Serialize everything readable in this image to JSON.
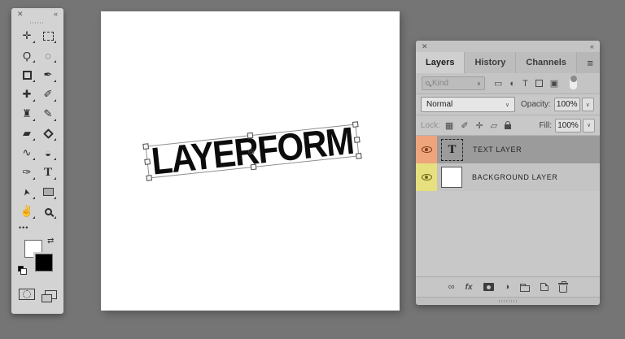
{
  "colors": {
    "workspace_background": "#757575",
    "canvas_background": "#FFFFFF",
    "selected_layer_row": "#9B9B9B",
    "text_layer_eye_background": "#EFA57C",
    "background_layer_eye_background": "#E6E07E",
    "foreground_swatch": "#FFFFFF",
    "background_swatch": "#000000"
  },
  "toolbar": {
    "close_icon": "✕",
    "collapse_icon": "«",
    "tools": [
      {
        "name": "move-tool",
        "glyph": "✛"
      },
      {
        "name": "rectangular-marquee-tool",
        "glyph": ""
      },
      {
        "name": "lasso-tool",
        "glyph": "Ϙ"
      },
      {
        "name": "quick-selection-tool",
        "glyph": "◌"
      },
      {
        "name": "crop-tool",
        "glyph": ""
      },
      {
        "name": "eyedropper-tool",
        "glyph": "✒"
      },
      {
        "name": "healing-brush-tool",
        "glyph": "✚"
      },
      {
        "name": "brush-tool",
        "glyph": "✐"
      },
      {
        "name": "clone-stamp-tool",
        "glyph": "♜"
      },
      {
        "name": "history-brush-tool",
        "glyph": "✎"
      },
      {
        "name": "eraser-tool",
        "glyph": "▰"
      },
      {
        "name": "paint-bucket-tool",
        "glyph": ""
      },
      {
        "name": "smudge-tool",
        "glyph": "∿"
      },
      {
        "name": "dodge-tool",
        "glyph": "◒"
      },
      {
        "name": "pen-tool",
        "glyph": "✑"
      },
      {
        "name": "type-tool",
        "glyph": "T"
      },
      {
        "name": "path-selection-tool",
        "glyph": "➤"
      },
      {
        "name": "shape-tool",
        "glyph": ""
      },
      {
        "name": "hand-tool",
        "glyph": "✌"
      },
      {
        "name": "zoom-tool",
        "glyph": ""
      }
    ],
    "more_tools_label": "•••",
    "swap_icon": "⇄"
  },
  "canvas": {
    "text": "LAYERFORM",
    "reference_icon": "⊕"
  },
  "layers_panel": {
    "close_icon": "✕",
    "collapse_icon": "«",
    "menu_icon": "≡",
    "chevron": "∨",
    "tabs": [
      {
        "label": "Layers",
        "active": true
      },
      {
        "label": "History",
        "active": false
      },
      {
        "label": "Channels",
        "active": false
      }
    ],
    "filter": {
      "placeholder": "Kind"
    },
    "filter_icons": [
      {
        "name": "filter-pixel-layers-icon",
        "glyph": "▭"
      },
      {
        "name": "filter-adjustment-layers-icon",
        "glyph": "◐"
      },
      {
        "name": "filter-type-layers-icon",
        "glyph": "T"
      },
      {
        "name": "filter-shape-layers-icon",
        "glyph": ""
      },
      {
        "name": "filter-smart-objects-icon",
        "glyph": "▣"
      }
    ],
    "blend": {
      "mode": "Normal",
      "opacity_label": "Opacity:",
      "opacity_value": "100%"
    },
    "lock": {
      "label": "Lock:",
      "icons": [
        {
          "name": "lock-transparency-icon",
          "glyph": "▦"
        },
        {
          "name": "lock-paint-icon",
          "glyph": "✐"
        },
        {
          "name": "lock-position-icon",
          "glyph": "✛"
        },
        {
          "name": "lock-artboard-icon",
          "glyph": "▱"
        },
        {
          "name": "lock-all-icon",
          "glyph": ""
        }
      ],
      "fill_label": "Fill:",
      "fill_value": "100%"
    },
    "layers": [
      {
        "name": "TEXT LAYER",
        "type": "text",
        "selected": true,
        "thumb_label": "T"
      },
      {
        "name": "BACKGROUND LAYER",
        "type": "background",
        "selected": false
      }
    ],
    "bottom_bar": [
      {
        "name": "link-layers-icon",
        "glyph": "∞"
      },
      {
        "name": "layer-effects-icon",
        "glyph": "fx"
      },
      {
        "name": "layer-mask-icon",
        "glyph": ""
      },
      {
        "name": "adjustment-layer-icon",
        "glyph": "◑"
      },
      {
        "name": "new-group-icon",
        "glyph": ""
      },
      {
        "name": "new-layer-icon",
        "glyph": ""
      },
      {
        "name": "delete-layer-icon",
        "glyph": ""
      }
    ]
  }
}
